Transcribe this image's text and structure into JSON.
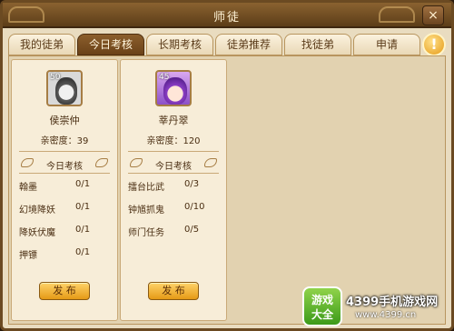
{
  "window": {
    "title": "师徒",
    "close_icon": "×"
  },
  "tabs": [
    {
      "label": "我的徒弟",
      "active": false
    },
    {
      "label": "今日考核",
      "active": true
    },
    {
      "label": "长期考核",
      "active": false
    },
    {
      "label": "徒弟推荐",
      "active": false
    },
    {
      "label": "找徒弟",
      "active": false
    },
    {
      "label": "申请",
      "active": false
    }
  ],
  "alert_icon": "!",
  "students": [
    {
      "level": "50",
      "name": "侯崇仲",
      "intimacy": "亲密度：39",
      "section_title": "今日考核",
      "tasks": [
        {
          "name": "翰墨",
          "progress": "0/1"
        },
        {
          "name": "幻境降妖",
          "progress": "0/1"
        },
        {
          "name": "降妖伏魔",
          "progress": "0/1"
        },
        {
          "name": "押镖",
          "progress": "0/1"
        }
      ],
      "publish_label": "发 布"
    },
    {
      "level": "45",
      "name": "莘丹翠",
      "intimacy": "亲密度：120",
      "section_title": "今日考核",
      "tasks": [
        {
          "name": "擂台比武",
          "progress": "0/3"
        },
        {
          "name": "钟馗抓鬼",
          "progress": "0/10"
        },
        {
          "name": "师门任务",
          "progress": "0/5"
        }
      ],
      "publish_label": "发 布"
    }
  ],
  "watermark": {
    "badge_line1": "游戏",
    "badge_line2": "大全",
    "text": "4399手机游戏网",
    "url": "www.4399.cn"
  }
}
